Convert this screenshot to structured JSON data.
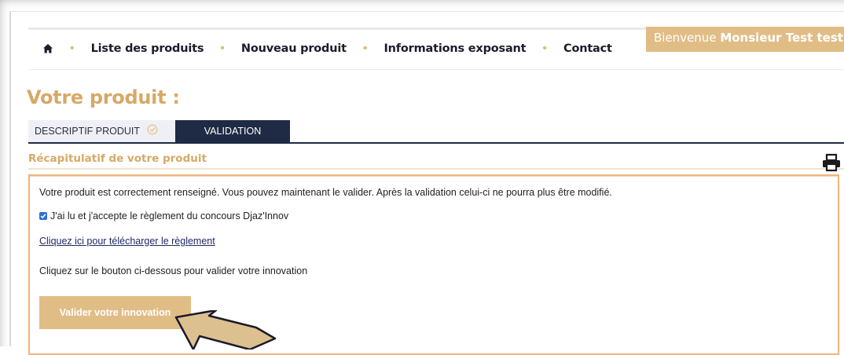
{
  "nav": {
    "items": [
      {
        "label": "Liste des produits"
      },
      {
        "label": "Nouveau produit"
      },
      {
        "label": "Informations exposant"
      },
      {
        "label": "Contact"
      }
    ],
    "separator": "•",
    "welcome_prefix": "Bienvenue",
    "welcome_name": "Monsieur Test test"
  },
  "page": {
    "title": "Votre produit :"
  },
  "tabs": [
    {
      "label": "DESCRIPTIF PRODUIT",
      "completed": true
    },
    {
      "label": "VALIDATION",
      "active": true
    }
  ],
  "recap": {
    "title": "Récapitulatif de votre produit",
    "message": "Votre produit est correctement renseigné. Vous pouvez maintenant le valider. Après la validation celui-ci ne pourra plus être modifié.",
    "accept_label": "J'ai lu et j'accepte le règlement du concours Djaz'Innov",
    "accept_checked": true,
    "download_link": "Cliquez ici pour télécharger le règlement",
    "instruction": "Cliquez sur le bouton ci-dessous pour valider votre innovation",
    "validate_button": "Valider votre innovation"
  },
  "icons": {
    "home": "home-icon",
    "check": "check-circle-icon",
    "print": "printer-icon",
    "pointer": "arrow-pointer-icon"
  },
  "colors": {
    "accent_gold": "#e1bd86",
    "title_gold": "#d7a966",
    "navy": "#1f2a44",
    "box_border": "#f0b47c",
    "checkbox_blue": "#2f6fd6"
  }
}
